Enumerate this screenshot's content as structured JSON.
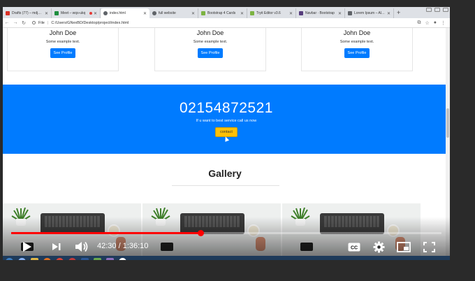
{
  "browser": {
    "tabs": [
      {
        "label": "Drafts (77) – mdjay@...",
        "color": "#d93025",
        "active": false
      },
      {
        "label": "Meet – wqs-ukq",
        "color": "#1e8e3e",
        "active": false,
        "recording": true
      },
      {
        "label": "index.html",
        "color": "#5f6368",
        "active": true
      },
      {
        "label": "full website",
        "color": "#5f6368",
        "active": false
      },
      {
        "label": "Bootstrap 4 Cards",
        "color": "#7cb342",
        "active": false
      },
      {
        "label": "Tryit Editor v3.6",
        "color": "#7cb342",
        "active": false
      },
      {
        "label": "Navbar · Bootstrap",
        "color": "#563d7c",
        "active": false
      },
      {
        "label": "Lorem Ipsum – All th",
        "color": "#5f6368",
        "active": false
      }
    ],
    "new_tab_label": "+",
    "address": {
      "scheme_label": "File",
      "path": "C:/Users/GNexBD/Desktop/project/index.html"
    }
  },
  "cards": [
    {
      "name": "John Doe",
      "text": "Some example text.",
      "button": "See Profile"
    },
    {
      "name": "John Doe",
      "text": "Some example text.",
      "button": "See Profile"
    },
    {
      "name": "John Doe",
      "text": "Some example text.",
      "button": "See Profile"
    }
  ],
  "hero": {
    "phone": "02154872521",
    "tagline": "If u want to best service call us now",
    "button": "contact",
    "bg_color": "#007bff"
  },
  "gallery": {
    "title": "Gallery",
    "images": [
      "laptop-desk-photo",
      "laptop-desk-photo",
      "laptop-desk-photo"
    ]
  },
  "video": {
    "time": "42:30 / 1:36:10",
    "progress_fraction": 0.441
  },
  "icons": {
    "play": "play-icon",
    "next": "next-icon",
    "volume": "volume-icon",
    "captions": "captions-icon",
    "settings": "settings-icon",
    "miniplayer": "miniplayer-icon",
    "fullscreen": "fullscreen-icon"
  },
  "colors": {
    "accent": "#007bff",
    "contact_button": "#ffc107",
    "progress": "#ff0000"
  }
}
